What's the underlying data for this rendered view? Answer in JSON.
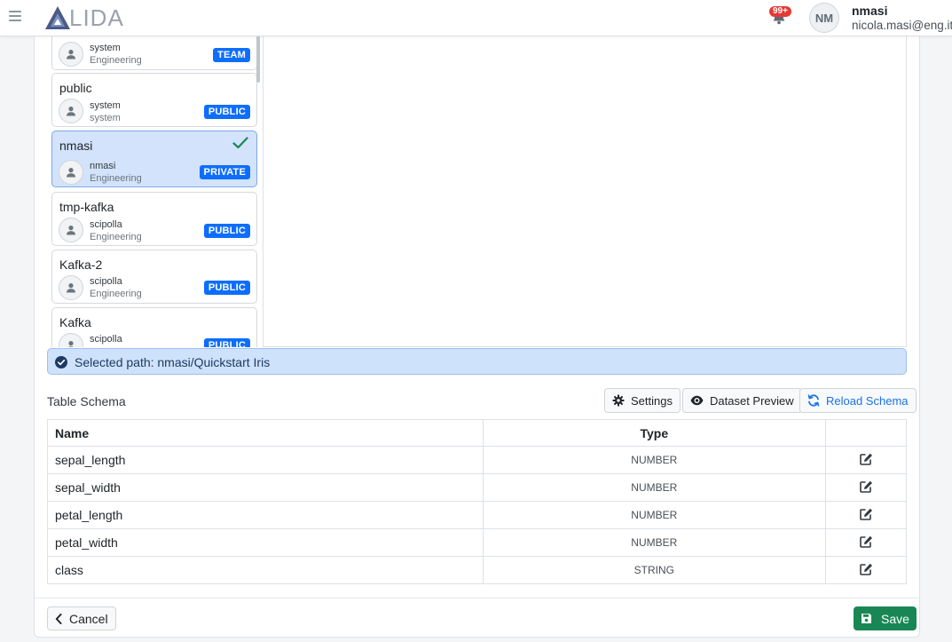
{
  "app": {
    "logo_text": "LIDA"
  },
  "header": {
    "notification_count": "99+",
    "user_initials": "NM",
    "user_name": "nmasi",
    "user_email": "nicola.masi@eng.it"
  },
  "folders": [
    {
      "name": "",
      "owner": "system",
      "org": "Engineering",
      "badge": "TEAM",
      "selected": false
    },
    {
      "name": "public",
      "owner": "system",
      "org": "system",
      "badge": "PUBLIC",
      "selected": false
    },
    {
      "name": "nmasi",
      "owner": "nmasi",
      "org": "Engineering",
      "badge": "PRIVATE",
      "selected": true
    },
    {
      "name": "tmp-kafka",
      "owner": "scipolla",
      "org": "Engineering",
      "badge": "PUBLIC",
      "selected": false
    },
    {
      "name": "Kafka-2",
      "owner": "scipolla",
      "org": "Engineering",
      "badge": "PUBLIC",
      "selected": false
    },
    {
      "name": "Kafka",
      "owner": "scipolla",
      "org": "",
      "badge": "PUBLIC",
      "selected": false
    }
  ],
  "selected_path": {
    "label": "Selected path: nmasi/Quickstart Iris"
  },
  "schema": {
    "title": "Table Schema",
    "settings_label": "Settings",
    "preview_label": "Dataset Preview",
    "reload_label": "Reload Schema",
    "columns": [
      "Name",
      "Type"
    ],
    "rows": [
      {
        "name": "sepal_length",
        "type": "NUMBER"
      },
      {
        "name": "sepal_width",
        "type": "NUMBER"
      },
      {
        "name": "petal_length",
        "type": "NUMBER"
      },
      {
        "name": "petal_width",
        "type": "NUMBER"
      },
      {
        "name": "class",
        "type": "STRING"
      }
    ]
  },
  "footer": {
    "cancel_label": "Cancel",
    "save_label": "Save"
  },
  "colors": {
    "primary": "#0d6efd",
    "success": "#198754",
    "selected_bg": "#d2e3fb",
    "badge_red": "#e53935"
  }
}
